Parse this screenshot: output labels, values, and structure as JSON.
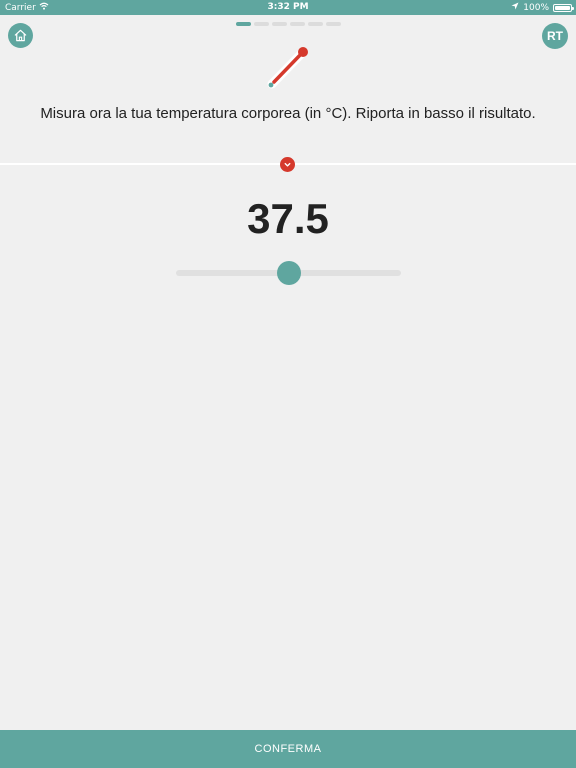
{
  "status_bar": {
    "carrier": "Carrier",
    "time": "3:32 PM",
    "battery": "100%",
    "battery_level": 1.0
  },
  "header": {
    "avatar_initials": "RT",
    "progress": {
      "total_steps": 6,
      "current_step": 1
    }
  },
  "question": {
    "icon": "thermometer-icon",
    "text": "Misura ora la tua temperatura corporea (in °C). Riporta in basso il risultato."
  },
  "slider": {
    "value": "37.5",
    "fraction": 0.5
  },
  "footer": {
    "confirm_label": "CONFERMA"
  },
  "colors": {
    "primary": "#5fa69f",
    "accent": "#d5392c",
    "background": "#f0f0f0",
    "text": "#222222"
  }
}
